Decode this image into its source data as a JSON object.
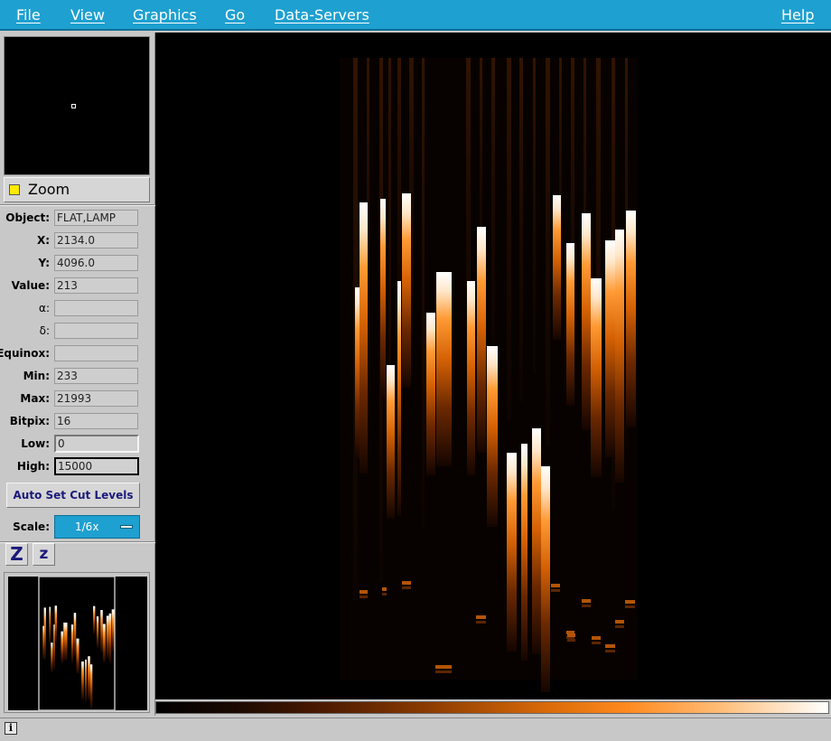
{
  "menu": {
    "file": "File",
    "view": "View",
    "graphics": "Graphics",
    "go": "Go",
    "data_servers": "Data-Servers",
    "help": "Help"
  },
  "zoom": {
    "label": "Zoom"
  },
  "info": {
    "object": {
      "label": "Object:",
      "value": "FLAT,LAMP"
    },
    "x": {
      "label": "X:",
      "value": "2134.0"
    },
    "y": {
      "label": "Y:",
      "value": "4096.0"
    },
    "value": {
      "label": "Value:",
      "value": "213"
    },
    "alpha": {
      "label": "α:",
      "value": ""
    },
    "delta": {
      "label": "δ:",
      "value": ""
    },
    "equinox": {
      "label": "Equinox:",
      "value": ""
    },
    "min": {
      "label": "Min:",
      "value": "233"
    },
    "max": {
      "label": "Max:",
      "value": "21993"
    },
    "bitpix": {
      "label": "Bitpix:",
      "value": "16"
    },
    "low": {
      "label": "Low:",
      "value": "0"
    },
    "high": {
      "label": "High:",
      "value": "15000"
    }
  },
  "auto_cut_label": "Auto Set Cut Levels",
  "scale": {
    "label": "Scale:",
    "value": "1/6x"
  },
  "zoom_buttons": {
    "zoom_in": "Z",
    "zoom_out": "z"
  },
  "status": {
    "icon_glyph": "i",
    "text": ""
  },
  "colors": {
    "menubar": "#1ea0d0",
    "panel": "#c8c8c8",
    "accent": "#ff8a1e",
    "highlight": "#ffea00"
  },
  "icons": [
    "info-icon",
    "chevron-down-icon",
    "zoom-indicator-icon"
  ]
}
